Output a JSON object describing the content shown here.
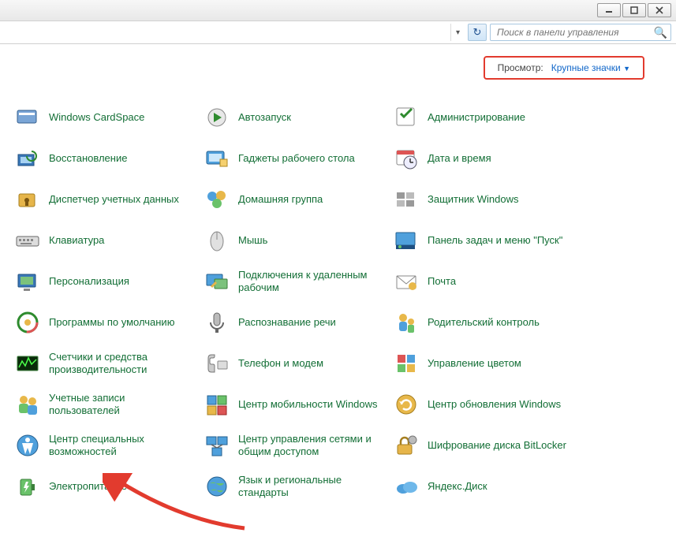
{
  "search": {
    "placeholder": "Поиск в панели управления"
  },
  "view": {
    "label": "Просмотр:",
    "value": "Крупные значки"
  },
  "items": [
    [
      {
        "id": "cardspace",
        "label": "Windows CardSpace"
      },
      {
        "id": "autorun",
        "label": "Автозапуск"
      },
      {
        "id": "admin",
        "label": "Администрирование"
      }
    ],
    [
      {
        "id": "recovery",
        "label": "Восстановление"
      },
      {
        "id": "gadgets",
        "label": "Гаджеты рабочего стола"
      },
      {
        "id": "datetime",
        "label": "Дата и время"
      }
    ],
    [
      {
        "id": "credmgr",
        "label": "Диспетчер учетных данных"
      },
      {
        "id": "homegroup",
        "label": "Домашняя группа"
      },
      {
        "id": "defender",
        "label": "Защитник Windows"
      }
    ],
    [
      {
        "id": "keyboard",
        "label": "Клавиатура"
      },
      {
        "id": "mouse",
        "label": "Мышь"
      },
      {
        "id": "taskbar",
        "label": "Панель задач и меню \"Пуск\""
      }
    ],
    [
      {
        "id": "personalization",
        "label": "Персонализация"
      },
      {
        "id": "remote",
        "label": "Подключения к удаленным рабочим"
      },
      {
        "id": "mail",
        "label": "Почта"
      }
    ],
    [
      {
        "id": "defaults",
        "label": "Программы по умолчанию"
      },
      {
        "id": "speech",
        "label": "Распознавание речи"
      },
      {
        "id": "parental",
        "label": "Родительский контроль"
      }
    ],
    [
      {
        "id": "perf",
        "label": "Счетчики и средства производительности"
      },
      {
        "id": "phone",
        "label": "Телефон и модем"
      },
      {
        "id": "color",
        "label": "Управление цветом"
      }
    ],
    [
      {
        "id": "users",
        "label": "Учетные записи пользователей"
      },
      {
        "id": "mobility",
        "label": "Центр мобильности Windows"
      },
      {
        "id": "update",
        "label": "Центр обновления Windows"
      }
    ],
    [
      {
        "id": "ease",
        "label": "Центр специальных возможностей"
      },
      {
        "id": "network",
        "label": "Центр управления сетями и общим доступом"
      },
      {
        "id": "bitlocker",
        "label": "Шифрование диска BitLocker"
      }
    ],
    [
      {
        "id": "power",
        "label": "Электропитание"
      },
      {
        "id": "region",
        "label": "Язык и региональные стандарты"
      },
      {
        "id": "yadisk",
        "label": "Яндекс.Диск"
      }
    ]
  ]
}
